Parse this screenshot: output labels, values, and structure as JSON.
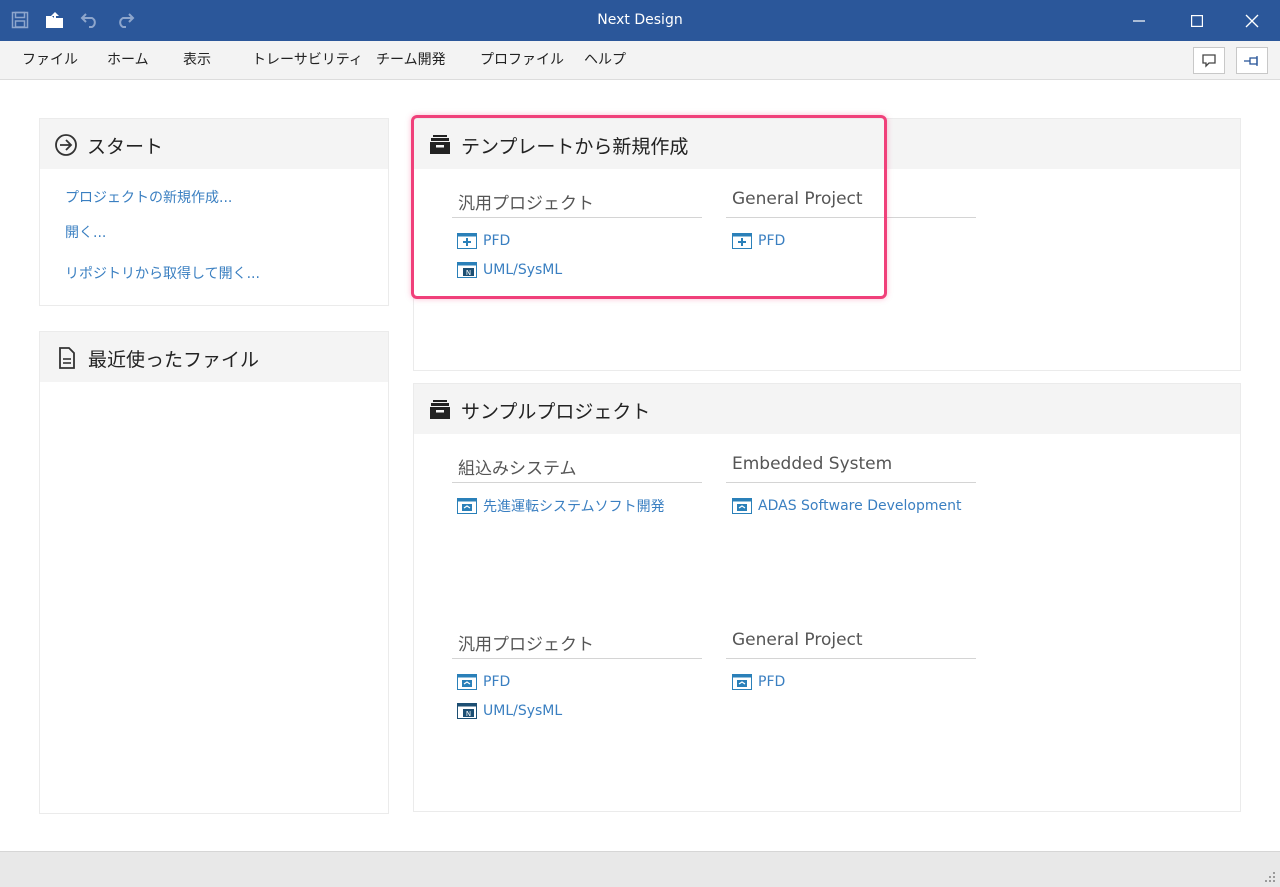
{
  "window": {
    "title": "Next Design"
  },
  "menu": {
    "items": [
      "ファイル",
      "ホーム",
      "表示",
      "トレーサビリティ",
      "チーム開発",
      "プロファイル",
      "ヘルプ"
    ]
  },
  "start": {
    "title": "スタート",
    "links": [
      "プロジェクトの新規作成...",
      "開く...",
      "リポジトリから取得して開く..."
    ]
  },
  "recent": {
    "title": "最近使ったファイル"
  },
  "templates": {
    "title": "テンプレートから新規作成",
    "columns": [
      {
        "heading": "汎用プロジェクト",
        "items": [
          "PFD",
          "UML/SysML"
        ]
      },
      {
        "heading": "General Project",
        "items": [
          "PFD"
        ]
      }
    ]
  },
  "samples": {
    "title": "サンプルプロジェクト",
    "groups": [
      {
        "columns": [
          {
            "heading": "組込みシステム",
            "items": [
              "先進運転システムソフト開発"
            ]
          },
          {
            "heading": "Embedded System",
            "items": [
              "ADAS Software Development"
            ]
          }
        ]
      },
      {
        "columns": [
          {
            "heading": "汎用プロジェクト",
            "items": [
              "PFD",
              "UML/SysML"
            ]
          },
          {
            "heading": "General Project",
            "items": [
              "PFD"
            ]
          }
        ]
      }
    ]
  },
  "colors": {
    "titlebar": "#2b579a",
    "link": "#3a7fc1",
    "highlight": "#f0407a"
  }
}
